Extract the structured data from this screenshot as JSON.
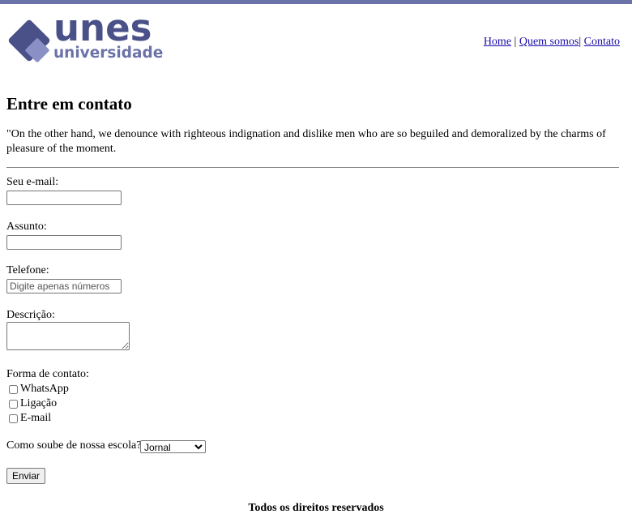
{
  "brand": {
    "name": "unes",
    "subtitle": "universidade",
    "primary_color": "#4a5088",
    "accent_color": "#6b72a8"
  },
  "nav": {
    "home": "Home",
    "separator1": " | ",
    "about": "Quem somos",
    "separator2": "| ",
    "contact": "Contato"
  },
  "page": {
    "title": "Entre em contato",
    "intro": "\"On the other hand, we denounce with righteous indignation and dislike men who are so beguiled and demoralized by the charms of pleasure of the moment."
  },
  "form": {
    "email_label": "Seu e-mail:",
    "email_value": "",
    "subject_label": "Assunto:",
    "subject_value": "",
    "phone_label": "Telefone:",
    "phone_placeholder": "Digite apenas números",
    "description_label": "Descrição:",
    "description_value": "",
    "contact_method_label": "Forma de contato:",
    "contact_methods": [
      "WhatsApp",
      "Ligação",
      "E-mail"
    ],
    "source_label": "Como soube de nossa escola?",
    "source_selected": "Jornal",
    "submit_label": "Enviar"
  },
  "footer": {
    "text": "Todos os direitos reservados"
  }
}
